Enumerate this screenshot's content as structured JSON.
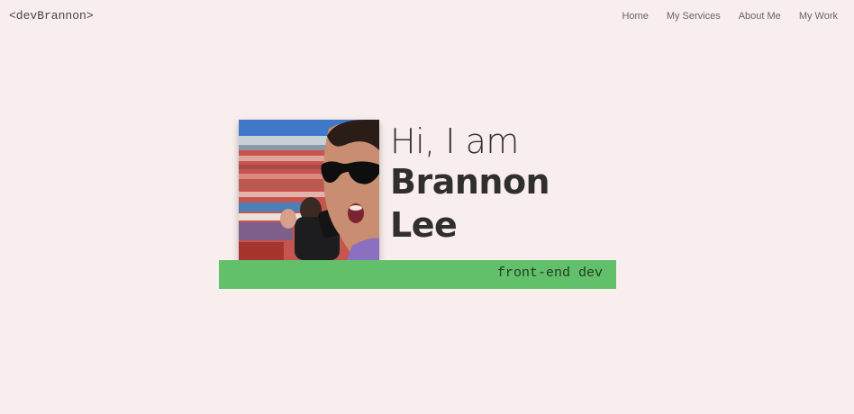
{
  "header": {
    "logo_text": "<devBrannon>",
    "nav": [
      {
        "label": "Home"
      },
      {
        "label": "My Services"
      },
      {
        "label": "About Me"
      },
      {
        "label": "My Work"
      }
    ]
  },
  "hero": {
    "greeting": "Hi, I am",
    "name": "Brannon Lee",
    "tagline": "front-end dev",
    "photo_alt": "Brannon Lee at a stadium wearing sunglasses"
  },
  "colors": {
    "background": "#f9eeee",
    "accent": "#62c06b",
    "text": "#333333"
  }
}
